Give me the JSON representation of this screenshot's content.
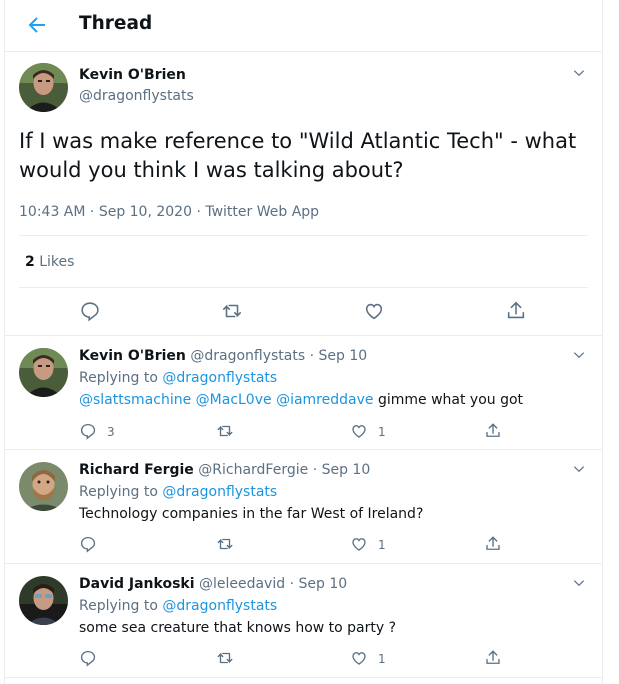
{
  "header": {
    "title": "Thread"
  },
  "main_tweet": {
    "author_name": "Kevin O'Brien",
    "handle": "@dragonflystats",
    "text": "If I was make reference to \"Wild Atlantic Tech\" - what would you think I was talking about?",
    "time": "10:43 AM",
    "date": "Sep 10, 2020",
    "client": "Twitter Web App",
    "likes_count": "2",
    "likes_label": "Likes"
  },
  "replies": [
    {
      "author_name": "Kevin O'Brien",
      "handle": "@dragonflystats",
      "date": "Sep 10",
      "replying_prefix": "Replying to",
      "replying_to": "@dragonflystats",
      "mentions": [
        "@slattsmachine",
        "@MacL0ve",
        "@iamreddave"
      ],
      "text": "gimme what you got",
      "reply_count": "3",
      "like_count": "1"
    },
    {
      "author_name": "Richard Fergie",
      "handle": "@RichardFergie",
      "date": "Sep 10",
      "replying_prefix": "Replying to",
      "replying_to": "@dragonflystats",
      "text": "Technology companies in the far West of Ireland?",
      "like_count": "1"
    },
    {
      "author_name": "David Jankoski",
      "handle": "@leleedavid",
      "date": "Sep 10",
      "replying_prefix": "Replying to",
      "replying_to": "@dragonflystats",
      "text": "some sea creature that knows how to party ?",
      "like_count": "1"
    }
  ],
  "colors": {
    "accent": "#1da1f2",
    "link": "#1b95e0",
    "muted": "#5b7083",
    "text": "#0f1419",
    "border": "#ebeef0"
  }
}
